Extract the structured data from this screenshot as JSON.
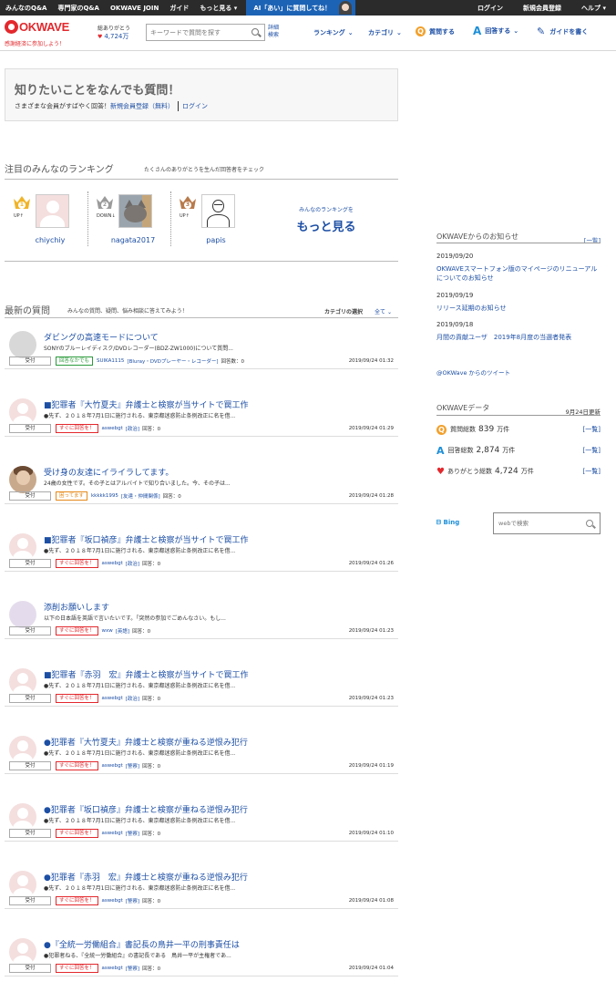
{
  "topbar": {
    "links": [
      "みんなのQ&A",
      "専門家のQ&A",
      "OKWAVE JOIN",
      "ガイド",
      "もっと見る"
    ],
    "ai_label": "AI「あい」に質問してね！",
    "right_links": [
      "ログイン",
      "新規会員登録",
      "ヘルプ"
    ]
  },
  "header": {
    "logo": "OKWAVE",
    "logo_sub": "感謝経済に参加しよう！",
    "thanks_label": "総ありがとう",
    "thanks_count": "4,724万",
    "search_placeholder": "キーワードで質問を探す",
    "advanced_search": "詳細\n検索",
    "nav": {
      "ranking": "ランキング",
      "category": "カテゴリ",
      "ask": "質問する",
      "answer": "回答する",
      "guide": "ガイドを書く"
    }
  },
  "hero": {
    "title": "知りたいことをなんでも質問！",
    "lead": "さまざまな会員がすばやく回答！",
    "register": "新規会員登録（無料）",
    "login": "ログイン"
  },
  "ranking": {
    "title": "注目のみんなのランキング",
    "subtitle": "たくさんのありがとうを生んだ回答者をチェック",
    "items": [
      {
        "rank": "1",
        "trend": "UP↑",
        "name": "chiychiy",
        "color": "#f0b428"
      },
      {
        "rank": "2",
        "trend": "DOWN↓",
        "name": "nagata2017",
        "color": "#9b9b9b"
      },
      {
        "rank": "3",
        "trend": "UP↑",
        "name": "papis",
        "color": "#b87a4b"
      }
    ],
    "more_small": "みんなのランキングを",
    "more_big": "もっと見る"
  },
  "latest": {
    "title": "最新の質問",
    "subtitle": "みんなの質問、疑問、悩み相談に答えてみよう！",
    "category_select_label": "カテゴリの選択",
    "category_select_value": "全て",
    "questions": [
      {
        "avatar": "gray",
        "title": "ダビングの高速モードについて",
        "desc": "SONYのブルーレイディスク/DVDレコーダー(BDZ-ZW1000)について質問...",
        "status": "受付",
        "tag": "回答なかでも",
        "tag_color": "green",
        "user": "SUIKA1115",
        "category": "[Bluray・DVDプレーヤー・レコーダー]",
        "answers": "回答数：0",
        "date": "2019/09/24 01:32"
      },
      {
        "avatar": "person",
        "title": "■犯罪者『大竹夏夫』弁護士と検察が当サイトで罠工作",
        "desc": "●先ず、２０１８年7月1日に施行される、東京都迷惑防止条例改正に名を借...",
        "status": "受付",
        "tag": "すぐに回答を！",
        "tag_color": "red",
        "user": "aswebgt",
        "category": "[政治]",
        "answers": "回答：0",
        "date": "2019/09/24 01:29"
      },
      {
        "avatar": "photo",
        "title": "受け身の友達にイライラしてます。",
        "desc": "24歳の女性です。その子とはアルバイトで知り合いました。今、その子は...",
        "status": "受付",
        "tag": "困ってます",
        "tag_color": "orange",
        "user": "kkkkk1995",
        "category": "[友達・仲間関係]",
        "answers": "回答：0",
        "date": "2019/09/24 01:28"
      },
      {
        "avatar": "person",
        "title": "■犯罪者『坂口禎彦』弁護士と検察が当サイトで罠工作",
        "desc": "●先ず、２０１８年7月1日に施行される、東京都迷惑防止条例改正に名を借...",
        "status": "受付",
        "tag": "すぐに回答を！",
        "tag_color": "red",
        "user": "aswebgt",
        "category": "[政治]",
        "answers": "回答：0",
        "date": "2019/09/24 01:26"
      },
      {
        "avatar": "lilac",
        "title": "添削お願いします",
        "desc": "以下の日本語を英語で言いたいです。「突然の参加でごめんなさい。もし...",
        "status": "受付",
        "tag": "すぐに回答を！",
        "tag_color": "red",
        "user": "wxw",
        "category": "[英語]",
        "answers": "回答：0",
        "date": "2019/09/24 01:23"
      },
      {
        "avatar": "person",
        "title": "■犯罪者『赤羽　宏』弁護士と検察が当サイトで罠工作",
        "desc": "●先ず、２０１８年7月1日に施行される、東京都迷惑防止条例改正に名を借...",
        "status": "受付",
        "tag": "すぐに回答を！",
        "tag_color": "red",
        "user": "aswebgt",
        "category": "[政治]",
        "answers": "回答：0",
        "date": "2019/09/24 01:23"
      },
      {
        "avatar": "person",
        "title": "●犯罪者『大竹夏夫』弁護士と検察が重ねる逆恨み犯行",
        "desc": "●先ず、２０１８年7月1日に施行される、東京都迷惑防止条例改正に名を借...",
        "status": "受付",
        "tag": "すぐに回答を！",
        "tag_color": "red",
        "user": "aswebgt",
        "category": "[警察]",
        "answers": "回答：0",
        "date": "2019/09/24 01:19"
      },
      {
        "avatar": "person",
        "title": "●犯罪者『坂口禎彦』弁護士と検察が重ねる逆恨み犯行",
        "desc": "●先ず、２０１８年7月1日に施行される、東京都迷惑防止条例改正に名を借...",
        "status": "受付",
        "tag": "すぐに回答を！",
        "tag_color": "red",
        "user": "aswebgt",
        "category": "[警察]",
        "answers": "回答：0",
        "date": "2019/09/24 01:10"
      },
      {
        "avatar": "person",
        "title": "●犯罪者『赤羽　宏』弁護士と検察が重ねる逆恨み犯行",
        "desc": "●先ず、２０１８年7月1日に施行される、東京都迷惑防止条例改正に名を借...",
        "status": "受付",
        "tag": "すぐに回答を！",
        "tag_color": "red",
        "user": "aswebgt",
        "category": "[警察]",
        "answers": "回答：0",
        "date": "2019/09/24 01:08"
      },
      {
        "avatar": "person",
        "title": "●『全統一労働組合』書記長の鳥井一平の刑事責任は",
        "desc": "●犯罪者ねる、『全統一労働組合』の書記長である　鳥井一平が主権者であ...",
        "status": "受付",
        "tag": "すぐに回答を！",
        "tag_color": "red",
        "user": "aswebgt",
        "category": "[警察]",
        "answers": "回答：0",
        "date": "2019/09/24 01:04"
      }
    ]
  },
  "news": {
    "title": "OKWAVEからのお知らせ",
    "list_link": "[一覧]",
    "items": [
      {
        "date": "2019/09/20",
        "text": "OKWAVEスマートフォン版のマイページのリニューアルについてのお知らせ"
      },
      {
        "date": "2019/09/19",
        "text": "リリース延期のお知らせ"
      },
      {
        "date": "2019/09/18",
        "text": "月間の貢献ユーザ　2019年8月度の当選者発表"
      }
    ],
    "tweet_link": "@OKWave からのツイート"
  },
  "okwave_data": {
    "title": "OKWAVEデータ",
    "updated": "9月24日更新",
    "stats": [
      {
        "label": "質問総数",
        "value": "839",
        "unit": "万件",
        "link": "[一覧]",
        "icon": "question-icon"
      },
      {
        "label": "回答総数",
        "value": "2,874",
        "unit": "万件",
        "link": "[一覧]",
        "icon": "answer-icon"
      },
      {
        "label": "ありがとう総数",
        "value": "4,724",
        "unit": "万件",
        "link": "[一覧]",
        "icon": "heart-icon"
      }
    ]
  },
  "bing": {
    "logo": "Bing",
    "placeholder": "webで検索"
  },
  "colors": {
    "brand_red": "#e3282d",
    "link_blue": "#1d4fa5",
    "topbar": "#2b2b2b",
    "ai_blue": "#1d63b5"
  }
}
